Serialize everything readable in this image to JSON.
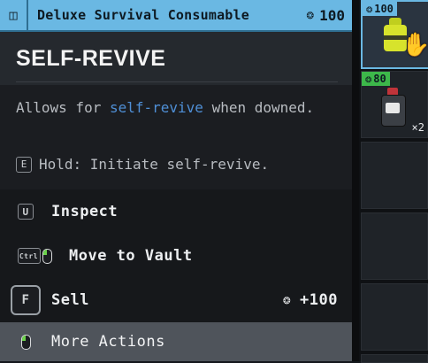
{
  "tooltip": {
    "item_name": "Deluxe Survival Consumable",
    "price": "100",
    "item_icon": "revive-kit-icon",
    "title": "SELF-REVIVE",
    "description_prefix": "Allows for ",
    "description_highlight": "self-revive",
    "description_suffix": " when downed.",
    "hold_key": "E",
    "hold_text": "Hold: Initiate self-revive.",
    "accent_color": "#6ab8e3",
    "highlight_color": "#4f8fd6"
  },
  "actions": [
    {
      "key": "U",
      "label": "Inspect"
    },
    {
      "key": "Ctrl",
      "label": "Move to Vault"
    },
    {
      "key": "F",
      "label": "Sell",
      "amount": "+100"
    },
    {
      "label": "More Actions"
    }
  ],
  "inventory": {
    "slots": [
      {
        "price": "100",
        "badge_color": "#6ab8e3",
        "icon": "self-revive-item-icon",
        "selected": true
      },
      {
        "price": "80",
        "badge_color": "#3db84a",
        "icon": "canister-item-icon",
        "qty": "×2"
      },
      {
        "empty": true
      },
      {
        "empty": true
      },
      {
        "empty": true
      },
      {
        "empty": true
      }
    ]
  }
}
